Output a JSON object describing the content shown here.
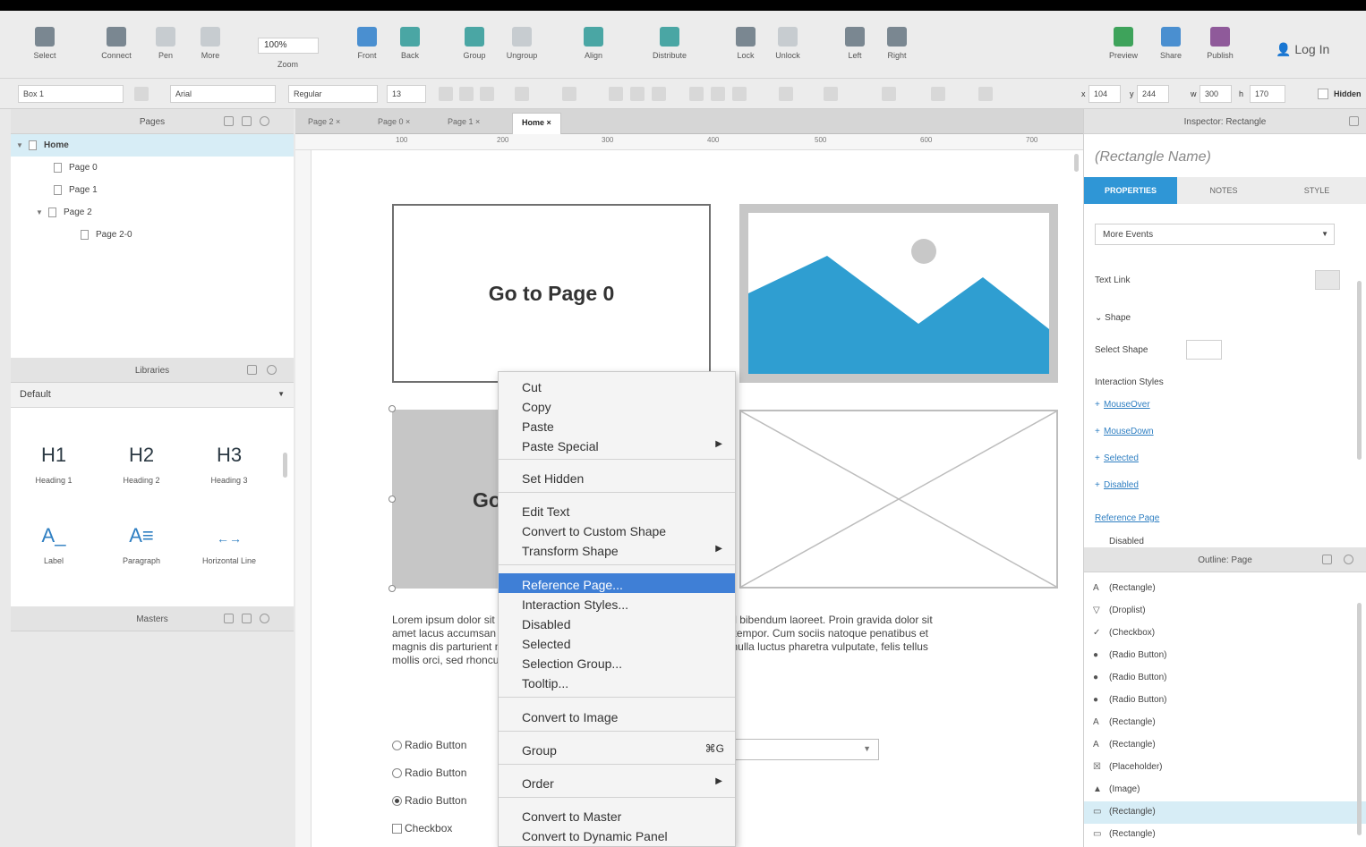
{
  "toolbar": {
    "items": [
      {
        "label": "Select",
        "icon": "select-icon"
      },
      {
        "label": "Connect",
        "icon": "connect-icon"
      },
      {
        "label": "Pen",
        "icon": "pen-icon"
      },
      {
        "label": "More",
        "icon": "more-icon"
      },
      {
        "label": "Front",
        "icon": "bring-front-icon"
      },
      {
        "label": "Back",
        "icon": "send-back-icon"
      },
      {
        "label": "Group",
        "icon": "group-icon"
      },
      {
        "label": "Ungroup",
        "icon": "ungroup-icon"
      },
      {
        "label": "Align",
        "icon": "align-icon"
      },
      {
        "label": "Distribute",
        "icon": "distribute-icon"
      },
      {
        "label": "Lock",
        "icon": "lock-icon"
      },
      {
        "label": "Unlock",
        "icon": "unlock-icon"
      },
      {
        "label": "Left",
        "icon": "left-icon"
      },
      {
        "label": "Right",
        "icon": "right-icon"
      },
      {
        "label": "Preview",
        "icon": "preview-icon"
      },
      {
        "label": "Share",
        "icon": "share-icon"
      },
      {
        "label": "Publish",
        "icon": "publish-icon"
      }
    ],
    "zoom": "100%",
    "zoom_label": "Zoom",
    "login": "Log In"
  },
  "format_bar": {
    "style": "Box 1",
    "font": "Arial",
    "weight": "Regular",
    "size": "13",
    "x": "104",
    "y": "244",
    "w": "300",
    "h": "170",
    "hidden": "Hidden"
  },
  "pages_panel": {
    "title": "Pages",
    "pages": [
      {
        "label": "Home",
        "level": 0,
        "selected": true
      },
      {
        "label": "Page 0",
        "level": 1
      },
      {
        "label": "Page 1",
        "level": 1
      },
      {
        "label": "Page 2",
        "level": 1
      },
      {
        "label": "Page 2-0",
        "level": 2
      }
    ]
  },
  "libraries_panel": {
    "title": "Libraries",
    "library": "Default",
    "widgets": [
      {
        "glyph": "H1",
        "label": "Heading 1"
      },
      {
        "glyph": "H2",
        "label": "Heading 2"
      },
      {
        "glyph": "H3",
        "label": "Heading 3"
      },
      {
        "glyph": "A_",
        "label": "Label"
      },
      {
        "glyph": "A≡",
        "label": "Paragraph"
      },
      {
        "glyph": "←→",
        "label": "Horizontal Line"
      }
    ]
  },
  "masters_panel": {
    "title": "Masters"
  },
  "tabs": [
    "Page 2",
    "Page 0",
    "Page 1",
    "Home"
  ],
  "ruler": [
    "100",
    "200",
    "300",
    "400",
    "500",
    "600",
    "700"
  ],
  "canvas": {
    "goto_text": "Go to Page 0",
    "gray_text": "Go",
    "lorem": "Lorem ipsum dolor sit amet, consectetur adipiscing elit. Aenean euismod bibendum laoreet. Proin gravida dolor sit amet lacus accumsan et viverra justo commodo. Proin sodales pulvinar tempor. Cum sociis natoque penatibus et magnis dis parturient montes, nascetur ridiculus mus. Nam fermentum, nulla luctus pharetra vulputate, felis tellus mollis orci, sed rhoncus sapien nunc eget.",
    "radios": [
      "Radio Button",
      "Radio Button",
      "Radio Button"
    ],
    "checkbox": "Checkbox",
    "image_sky": "#ffffff",
    "image_mountain": "#2f9ed1",
    "image_sun": "#c8c8c8"
  },
  "context_menu": {
    "groups": [
      [
        {
          "label": "Cut"
        },
        {
          "label": "Copy"
        },
        {
          "label": "Paste"
        },
        {
          "label": "Paste Special",
          "submenu": "▶"
        }
      ],
      [
        {
          "label": "Set Hidden"
        }
      ],
      [
        {
          "label": "Edit Text"
        },
        {
          "label": "Convert to Custom Shape"
        },
        {
          "label": "Transform Shape",
          "submenu": "▶"
        }
      ],
      [
        {
          "label": "Reference Page...",
          "highlighted": true
        },
        {
          "label": "Interaction Styles..."
        },
        {
          "label": "Disabled"
        },
        {
          "label": "Selected"
        },
        {
          "label": "Selection Group..."
        },
        {
          "label": "Tooltip..."
        }
      ],
      [
        {
          "label": "Convert to Image"
        }
      ],
      [
        {
          "label": "Group",
          "shortcut": "⌘G"
        }
      ],
      [
        {
          "label": "Order",
          "submenu": "▶"
        }
      ],
      [
        {
          "label": "Convert to Master"
        },
        {
          "label": "Convert to Dynamic Panel"
        }
      ]
    ]
  },
  "inspector": {
    "title": "Inspector: Rectangle",
    "name_placeholder": "(Rectangle Name)",
    "tabs": [
      "PROPERTIES",
      "NOTES",
      "STYLE"
    ],
    "events": "More Events",
    "text_link": "Text Link",
    "shape_section": "Shape",
    "select_shape": "Select Shape",
    "interaction_styles": "Interaction Styles",
    "styles": [
      "MouseOver",
      "MouseDown",
      "Selected",
      "Disabled"
    ],
    "reference_page": "Reference Page",
    "disabled": "Disabled"
  },
  "outline": {
    "title": "Outline: Page",
    "items": [
      {
        "icon": "A",
        "label": "(Rectangle)"
      },
      {
        "icon": "▽",
        "label": "(Droplist)"
      },
      {
        "icon": "✓",
        "label": "(Checkbox)"
      },
      {
        "icon": "●",
        "label": "(Radio Button)"
      },
      {
        "icon": "●",
        "label": "(Radio Button)"
      },
      {
        "icon": "●",
        "label": "(Radio Button)"
      },
      {
        "icon": "A",
        "label": "(Rectangle)"
      },
      {
        "icon": "A",
        "label": "(Rectangle)"
      },
      {
        "icon": "☒",
        "label": "(Placeholder)"
      },
      {
        "icon": "▲",
        "label": "(Image)"
      },
      {
        "icon": "▭",
        "label": "(Rectangle)",
        "selected": true
      },
      {
        "icon": "▭",
        "label": "(Rectangle)"
      }
    ]
  }
}
